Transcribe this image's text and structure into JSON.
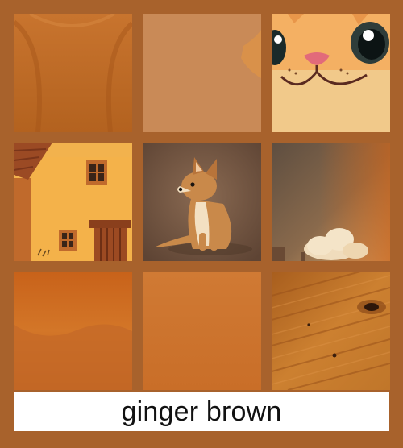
{
  "caption": {
    "label": "ginger brown"
  },
  "tiles": [
    {
      "name": "draped-fabric",
      "interactable": false
    },
    {
      "name": "flat-swatch",
      "interactable": false
    },
    {
      "name": "cartoon-cat-face",
      "interactable": false
    },
    {
      "name": "cartoon-house",
      "interactable": false
    },
    {
      "name": "sitting-fox-cub",
      "interactable": false
    },
    {
      "name": "sepia-clouds",
      "interactable": false
    },
    {
      "name": "gradient-wave",
      "interactable": false
    },
    {
      "name": "gradient-swatch",
      "interactable": false
    },
    {
      "name": "wood-grain",
      "interactable": false
    }
  ],
  "colors": {
    "background": "#a8622c",
    "caption_bg": "#ffffff",
    "caption_text": "#111111"
  }
}
